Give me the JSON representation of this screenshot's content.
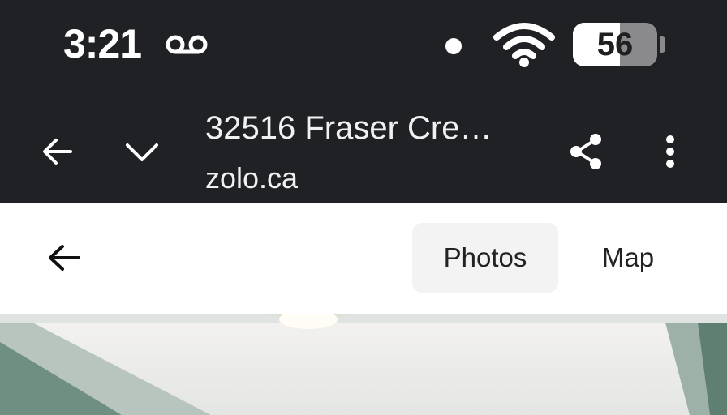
{
  "status_bar": {
    "time": "3:21",
    "battery_level": "56",
    "battery_fraction": 0.56,
    "icons": [
      "voicemail-icon",
      "notification-dot-icon",
      "wifi-icon",
      "battery-icon"
    ]
  },
  "browser": {
    "page_title": "32516 Fraser Cre…",
    "domain": "zolo.ca",
    "icons": [
      "back-arrow-icon",
      "chevron-down-icon",
      "share-icon",
      "more-vertical-icon"
    ]
  },
  "site_header": {
    "tabs": [
      {
        "label": "Photos",
        "selected": true
      },
      {
        "label": "Map",
        "selected": false
      }
    ],
    "icons": [
      "back-arrow-icon"
    ]
  },
  "colors": {
    "chrome_dark": "#202124",
    "tab_selected_bg": "#f3f3f3",
    "text_dark": "#222222"
  }
}
